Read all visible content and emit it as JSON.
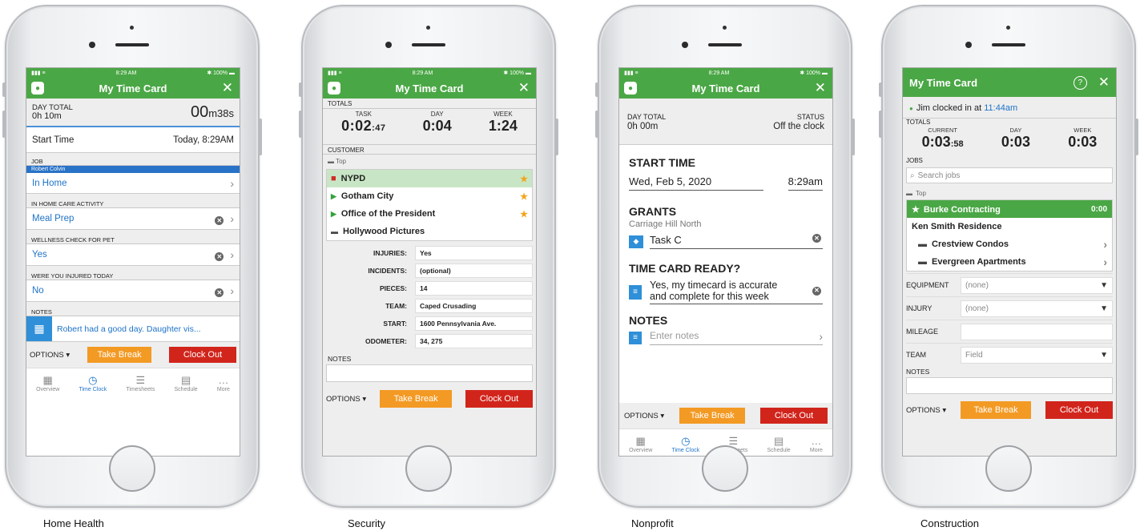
{
  "common": {
    "signal": "▮▮▮ ≡",
    "time": "8:29 AM",
    "battery": "✱ 100% ▬",
    "options": "OPTIONS ▾",
    "take_break": "Take Break",
    "clock_out": "Clock Out",
    "tabs": [
      {
        "label": "Overview",
        "icon": "▦"
      },
      {
        "label": "Time Clock",
        "icon": "◷"
      },
      {
        "label": "Timesheets",
        "icon": "☰"
      },
      {
        "label": "Schedule",
        "icon": "▤"
      },
      {
        "label": "More",
        "icon": "…"
      }
    ],
    "accent": "#4aa745",
    "link": "#1e73c8",
    "orange": "#f39a24",
    "red": "#d1251c"
  },
  "p1": {
    "caption": "Home Health",
    "title": "My Time Card",
    "day_total_label": "DAY TOTAL",
    "day_total": "0h 10m",
    "clock_h": "00",
    "clock_m": "m38s",
    "start_label": "Start Time",
    "start_value": "Today, 8:29AM",
    "job_label": "JOB",
    "job_chip": "Robert Colvin",
    "job_value": "In Home",
    "act_label": "IN HOME CARE ACTIVITY",
    "act_value": "Meal Prep",
    "pet_label": "WELLNESS CHECK FOR PET",
    "pet_value": "Yes",
    "inj_label": "WERE YOU INJURED TODAY",
    "inj_value": "No",
    "notes_label": "NOTES",
    "notes_value": "Robert had a good day. Daughter vis..."
  },
  "p2": {
    "caption": "Security",
    "title": "My Time Card",
    "totals": "TOTALS",
    "cols": [
      {
        "label": "TASK",
        "big": "0:02",
        "small": ":47"
      },
      {
        "label": "DAY",
        "big": "0:04",
        "small": ""
      },
      {
        "label": "WEEK",
        "big": "1:24",
        "small": ""
      }
    ],
    "customer": "CUSTOMER",
    "top": "Top",
    "items": [
      {
        "name": "NYPD",
        "mark": "■",
        "star": "★"
      },
      {
        "name": "Gotham City",
        "mark": "▶",
        "star": "★"
      },
      {
        "name": "Office of the President",
        "mark": "▶",
        "star": "★"
      },
      {
        "name": "Hollywood Pictures",
        "mark": "▬",
        "star": ""
      }
    ],
    "fields": [
      {
        "label": "INJURIES:",
        "value": "Yes"
      },
      {
        "label": "INCIDENTS:",
        "value": "(optional)"
      },
      {
        "label": "PIECES:",
        "value": "14"
      },
      {
        "label": "TEAM:",
        "value": "Caped Crusading"
      },
      {
        "label": "START:",
        "value": "1600 Pennsylvania Ave."
      },
      {
        "label": "ODOMETER:",
        "value": "34, 275"
      }
    ],
    "notes": "NOTES"
  },
  "p3": {
    "caption": "Nonprofit",
    "title": "My Time Card",
    "day_total_label": "DAY TOTAL",
    "day_total": "0h 00m",
    "status_label": "STATUS",
    "status_value": "Off the clock",
    "start_head": "START TIME",
    "start_date": "Wed, Feb 5, 2020",
    "start_time": "8:29am",
    "grants_head": "GRANTS",
    "grants_sub": "Carriage Hill North",
    "task": "Task C",
    "ready_head": "TIME CARD READY?",
    "ready_value1": "Yes, my timecard is accurate",
    "ready_value2": "and complete for this week",
    "notes_head": "NOTES",
    "notes_placeholder": "Enter notes"
  },
  "p4": {
    "caption": "Construction",
    "title": "My Time Card",
    "help": "?",
    "clocked": "Jim clocked in at",
    "clocked_time": "11:44am",
    "totals": "TOTALS",
    "cols": [
      {
        "label": "CURRENT",
        "big": "0:03",
        "small": ":58"
      },
      {
        "label": "DAY",
        "big": "0:03",
        "small": ""
      },
      {
        "label": "WEEK",
        "big": "0:03",
        "small": ""
      }
    ],
    "jobs": "JOBS",
    "search_placeholder": "Search jobs",
    "top": "Top",
    "fav": "Burke Contracting",
    "fav_time": "0:00",
    "sub": "Ken Smith Residence",
    "folders": [
      "Crestview Condos",
      "Evergreen Apartments"
    ],
    "fields": [
      {
        "label": "EQUIPMENT",
        "value": "(none)",
        "dd": true
      },
      {
        "label": "INJURY",
        "value": "(none)",
        "dd": true
      },
      {
        "label": "MILEAGE",
        "value": "",
        "dd": false
      },
      {
        "label": "TEAM",
        "value": "Field",
        "dd": true
      }
    ],
    "notes": "NOTES"
  }
}
